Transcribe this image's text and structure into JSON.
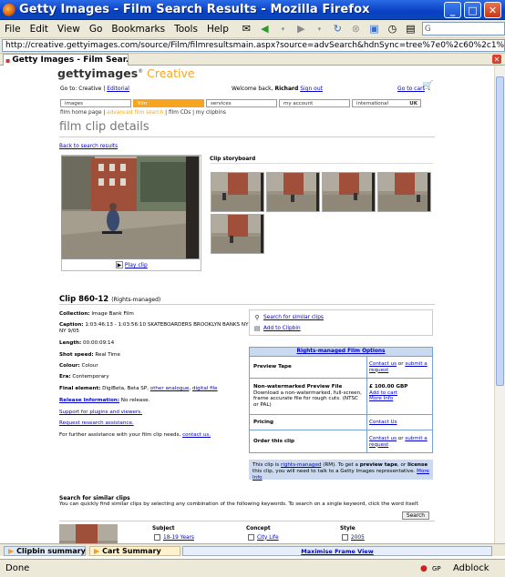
{
  "window": {
    "title": "Getty Images - Film Search Results - Mozilla Firefox"
  },
  "menu": [
    "File",
    "Edit",
    "View",
    "Go",
    "Bookmarks",
    "Tools",
    "Help"
  ],
  "url": "http://creative.gettyimages.com/source/Film/filmresultsmain.aspx?source=advSearch&hdnSync=tree%7e0%2c60%2c1%2c3%2c255%",
  "search_placeholder": "G",
  "tab": {
    "label": "Getty Images - Film Sear..."
  },
  "header": {
    "logo_text": "gettyimages",
    "logo_reg": "®",
    "logo_creative": "Creative",
    "goto_label": "Go to:",
    "goto_creative": "Creative",
    "goto_editorial": "Editorial",
    "welcome": "Welcome back,",
    "user": "Richard",
    "signout": "Sign out",
    "gotocart": "Go to cart"
  },
  "nav": {
    "images": "images",
    "film": "film",
    "services": "services",
    "account": "my account",
    "international": "international",
    "country": "UK"
  },
  "subnav": {
    "home": "film home page",
    "advanced": "advanced film search",
    "cds": "film CDs",
    "clipbins": "my clipbins"
  },
  "page_title": "film clip details",
  "back_link": "Back to search results",
  "play_clip": "Play clip",
  "storyboard_label": "Clip storyboard",
  "clip": {
    "id": "Clip 860-12",
    "rights": "(Rights-managed)",
    "collection_label": "Collection:",
    "collection": "Image Bank Film",
    "caption_label": "Caption:",
    "caption": "1:03:46:13 - 1:03:56:10 SKATEBOARDERS BROOKLYN BANKS NY NY 9/05",
    "length_label": "Length:",
    "length": "00:00:09:14",
    "speed_label": "Shot speed:",
    "speed": "Real Time",
    "colour_label": "Colour:",
    "colour": "Colour",
    "era_label": "Era:",
    "era": "Contemporary",
    "final_label": "Final element:",
    "final": "DigiBeta, Beta SP,",
    "final_link1": "other analogue",
    "final_link2": "digital file",
    "release_label": "Release Information:",
    "release": "No release.",
    "support_link": "Support for plugins and viewers.",
    "research_link": "Request research assistance.",
    "further": "For further assistance with your film clip needs,",
    "contact": "contact us."
  },
  "side_actions": {
    "search_similar": "Search for similar clips",
    "add_clipbin": "Add to Clipbin"
  },
  "options": {
    "title": "Rights-managed Film Options",
    "rows": [
      {
        "label": "Preview Tape",
        "action1": "Contact us",
        "or": "or",
        "action2": "submit a request"
      },
      {
        "label": "Non-watermarked Preview File",
        "desc": "Download a non-watermarked, full-screen, frame accurate file for rough cuts. (NTSC or PAL)",
        "price": "£ 100.00 GBP",
        "add": "Add to cart",
        "more": "More Info"
      },
      {
        "label": "Pricing",
        "action1": "Contact Us"
      },
      {
        "label": "Order this clip",
        "action1": "Contact us",
        "or": "or",
        "action2": "submit a request"
      }
    ],
    "note1": "This clip is",
    "note_link": "rights-managed",
    "note2": "(RM). To get a",
    "note_b1": "preview tape",
    "note3": ", or",
    "note_b2": "license",
    "note4": "this clip, you will need to talk to a Getty Images representative.",
    "note_more": "More Info"
  },
  "similar": {
    "title": "Search for similar clips",
    "desc": "You can quickly find similar clips by selecting any combination of the following keywords. To search on a single keyword, click the word itself.",
    "search_btn": "Search",
    "cols": [
      {
        "head": "Subject",
        "item": "18-19 Years"
      },
      {
        "head": "Concept",
        "item": "City Life"
      },
      {
        "head": "Style",
        "item": "2005"
      }
    ]
  },
  "bottom": {
    "clipbin": "Clipbin summary",
    "cart": "Cart Summary",
    "maximise": "Maximise Frame View"
  },
  "status": {
    "done": "Done",
    "gp": "GP",
    "adblock": "Adblock"
  }
}
